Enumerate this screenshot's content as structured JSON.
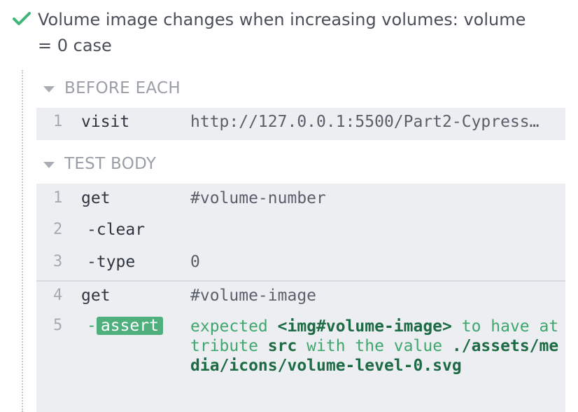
{
  "test": {
    "status_icon": "check-icon",
    "title": "Volume image changes when increasing volumes: volume = 0 case"
  },
  "colors": {
    "pass_green": "#3fb578",
    "assert_badge": "#4fb07e",
    "command_bg": "#edeef1",
    "hook_header": "#9a9ea7"
  },
  "before_each": {
    "header": "BEFORE EACH",
    "commands": [
      {
        "num": "1",
        "method": "visit",
        "message": "http://127.0.0.1:5500/Part2-Cypress…"
      }
    ]
  },
  "test_body": {
    "header": "TEST BODY",
    "commands": [
      {
        "num": "1",
        "method": "get",
        "message": "#volume-number"
      },
      {
        "num": "2",
        "method": "clear",
        "message": ""
      },
      {
        "num": "3",
        "method": "type",
        "message": "0"
      },
      {
        "num": "4",
        "method": "get",
        "message": "#volume-image"
      },
      {
        "num": "5",
        "method": "assert",
        "message_parts": {
          "p1": "expected ",
          "p2": "<img#volume-image>",
          "p3": " to have attribute ",
          "p4": "src",
          "p5": " with the value ",
          "p6": "./assets/media/icons/volume-level-0.svg"
        }
      }
    ]
  }
}
